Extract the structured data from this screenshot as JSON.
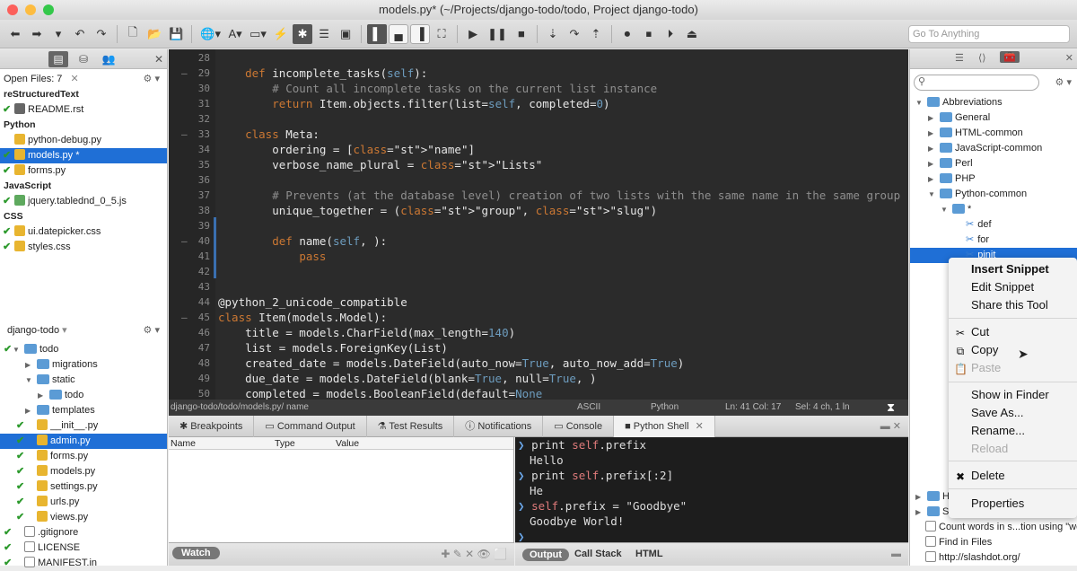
{
  "window": {
    "title": "models.py* (~/Projects/django-todo/todo, Project django-todo)"
  },
  "toolbar": {
    "goto_placeholder": "Go To Anything"
  },
  "left": {
    "open_files_label": "Open Files: 7",
    "groups": [
      {
        "name": "reStructuredText",
        "files": [
          "README.rst"
        ]
      },
      {
        "name": "Python",
        "files": [
          "python-debug.py",
          "models.py *",
          "forms.py"
        ]
      },
      {
        "name": "JavaScript",
        "files": [
          "jquery.tablednd_0_5.js"
        ]
      },
      {
        "name": "CSS",
        "files": [
          "ui.datepicker.css",
          "styles.css"
        ]
      }
    ],
    "project_label": "django-todo",
    "tree": [
      "todo",
      "migrations",
      "static",
      "todo",
      "templates",
      "__init__.py",
      "admin.py",
      "forms.py",
      "models.py",
      "settings.py",
      "urls.py",
      "views.py",
      ".gitignore",
      "LICENSE",
      "MANIFEST.in"
    ]
  },
  "editor": {
    "lines": [
      {
        "n": "28",
        "t": ""
      },
      {
        "n": "29",
        "t": "    def incomplete_tasks(self):"
      },
      {
        "n": "30",
        "t": "        # Count all incomplete tasks on the current list instance"
      },
      {
        "n": "31",
        "t": "        return Item.objects.filter(list=self, completed=0)"
      },
      {
        "n": "32",
        "t": ""
      },
      {
        "n": "33",
        "t": "    class Meta:"
      },
      {
        "n": "34",
        "t": "        ordering = [\"name\"]"
      },
      {
        "n": "35",
        "t": "        verbose_name_plural = \"Lists\""
      },
      {
        "n": "36",
        "t": ""
      },
      {
        "n": "37",
        "t": "        # Prevents (at the database level) creation of two lists with the same name in the same group"
      },
      {
        "n": "38",
        "t": "        unique_together = (\"group\", \"slug\")"
      },
      {
        "n": "39",
        "t": ""
      },
      {
        "n": "40",
        "t": "        def name(self, ):"
      },
      {
        "n": "41",
        "t": "            pass"
      },
      {
        "n": "42",
        "t": ""
      },
      {
        "n": "43",
        "t": ""
      },
      {
        "n": "44",
        "t": "@python_2_unicode_compatible"
      },
      {
        "n": "45",
        "t": "class Item(models.Model):"
      },
      {
        "n": "46",
        "t": "    title = models.CharField(max_length=140)"
      },
      {
        "n": "47",
        "t": "    list = models.ForeignKey(List)"
      },
      {
        "n": "48",
        "t": "    created_date = models.DateField(auto_now=True, auto_now_add=True)"
      },
      {
        "n": "49",
        "t": "    due_date = models.DateField(blank=True, null=True, )"
      },
      {
        "n": "50",
        "t": "    completed = models.BooleanField(default=None"
      }
    ]
  },
  "status": {
    "path": "django-todo/todo/models.py/ name",
    "encoding": "ASCII",
    "language": "Python",
    "position": "Ln: 41 Col: 17",
    "selection": "Sel: 4 ch, 1 ln"
  },
  "bottom_tabs": [
    "Breakpoints",
    "Command Output",
    "Test Results",
    "Notifications",
    "Console",
    "Python Shell"
  ],
  "variables": {
    "headers": [
      "Name",
      "Type",
      "Value"
    ],
    "watch_label": "Watch"
  },
  "shell": {
    "lines": [
      {
        "prompt": true,
        "t": "print self.prefix"
      },
      {
        "prompt": false,
        "t": "Hello"
      },
      {
        "prompt": true,
        "t": "print self.prefix[:2]"
      },
      {
        "prompt": false,
        "t": "He"
      },
      {
        "prompt": true,
        "t": "self.prefix = \"Goodbye\""
      },
      {
        "prompt": false,
        "t": "Goodbye World!"
      }
    ],
    "tabs": [
      "Output",
      "Call Stack",
      "HTML"
    ]
  },
  "right": {
    "tree": [
      "Abbreviations",
      "General",
      "HTML-common",
      "JavaScript-common",
      "Perl",
      "PHP",
      "Python-common",
      "*",
      "def",
      "for",
      "pinit"
    ],
    "bottom": [
      "HT",
      "Sa",
      "Count words in s...tion using \"wc\"",
      "Find in Files",
      "http://slashdot.org/"
    ]
  },
  "context_menu": {
    "items": [
      "Insert Snippet",
      "Edit Snippet",
      "Share this Tool",
      "Cut",
      "Copy",
      "Paste",
      "Show in Finder",
      "Save As...",
      "Rename...",
      "Reload",
      "Delete",
      "Properties"
    ]
  }
}
